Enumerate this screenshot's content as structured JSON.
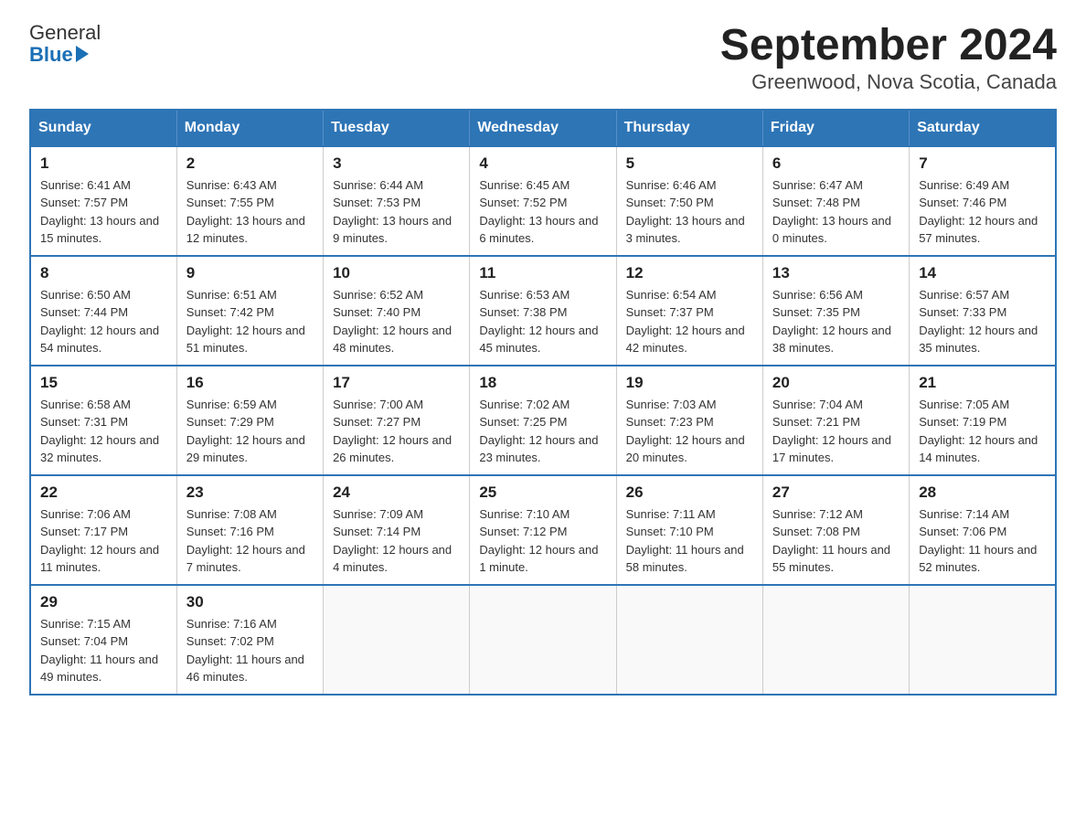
{
  "logo": {
    "text_general": "General",
    "text_blue": "Blue"
  },
  "title": "September 2024",
  "subtitle": "Greenwood, Nova Scotia, Canada",
  "days_header": [
    "Sunday",
    "Monday",
    "Tuesday",
    "Wednesday",
    "Thursday",
    "Friday",
    "Saturday"
  ],
  "weeks": [
    [
      {
        "day": "1",
        "sunrise": "6:41 AM",
        "sunset": "7:57 PM",
        "daylight": "13 hours and 15 minutes."
      },
      {
        "day": "2",
        "sunrise": "6:43 AM",
        "sunset": "7:55 PM",
        "daylight": "13 hours and 12 minutes."
      },
      {
        "day": "3",
        "sunrise": "6:44 AM",
        "sunset": "7:53 PM",
        "daylight": "13 hours and 9 minutes."
      },
      {
        "day": "4",
        "sunrise": "6:45 AM",
        "sunset": "7:52 PM",
        "daylight": "13 hours and 6 minutes."
      },
      {
        "day": "5",
        "sunrise": "6:46 AM",
        "sunset": "7:50 PM",
        "daylight": "13 hours and 3 minutes."
      },
      {
        "day": "6",
        "sunrise": "6:47 AM",
        "sunset": "7:48 PM",
        "daylight": "13 hours and 0 minutes."
      },
      {
        "day": "7",
        "sunrise": "6:49 AM",
        "sunset": "7:46 PM",
        "daylight": "12 hours and 57 minutes."
      }
    ],
    [
      {
        "day": "8",
        "sunrise": "6:50 AM",
        "sunset": "7:44 PM",
        "daylight": "12 hours and 54 minutes."
      },
      {
        "day": "9",
        "sunrise": "6:51 AM",
        "sunset": "7:42 PM",
        "daylight": "12 hours and 51 minutes."
      },
      {
        "day": "10",
        "sunrise": "6:52 AM",
        "sunset": "7:40 PM",
        "daylight": "12 hours and 48 minutes."
      },
      {
        "day": "11",
        "sunrise": "6:53 AM",
        "sunset": "7:38 PM",
        "daylight": "12 hours and 45 minutes."
      },
      {
        "day": "12",
        "sunrise": "6:54 AM",
        "sunset": "7:37 PM",
        "daylight": "12 hours and 42 minutes."
      },
      {
        "day": "13",
        "sunrise": "6:56 AM",
        "sunset": "7:35 PM",
        "daylight": "12 hours and 38 minutes."
      },
      {
        "day": "14",
        "sunrise": "6:57 AM",
        "sunset": "7:33 PM",
        "daylight": "12 hours and 35 minutes."
      }
    ],
    [
      {
        "day": "15",
        "sunrise": "6:58 AM",
        "sunset": "7:31 PM",
        "daylight": "12 hours and 32 minutes."
      },
      {
        "day": "16",
        "sunrise": "6:59 AM",
        "sunset": "7:29 PM",
        "daylight": "12 hours and 29 minutes."
      },
      {
        "day": "17",
        "sunrise": "7:00 AM",
        "sunset": "7:27 PM",
        "daylight": "12 hours and 26 minutes."
      },
      {
        "day": "18",
        "sunrise": "7:02 AM",
        "sunset": "7:25 PM",
        "daylight": "12 hours and 23 minutes."
      },
      {
        "day": "19",
        "sunrise": "7:03 AM",
        "sunset": "7:23 PM",
        "daylight": "12 hours and 20 minutes."
      },
      {
        "day": "20",
        "sunrise": "7:04 AM",
        "sunset": "7:21 PM",
        "daylight": "12 hours and 17 minutes."
      },
      {
        "day": "21",
        "sunrise": "7:05 AM",
        "sunset": "7:19 PM",
        "daylight": "12 hours and 14 minutes."
      }
    ],
    [
      {
        "day": "22",
        "sunrise": "7:06 AM",
        "sunset": "7:17 PM",
        "daylight": "12 hours and 11 minutes."
      },
      {
        "day": "23",
        "sunrise": "7:08 AM",
        "sunset": "7:16 PM",
        "daylight": "12 hours and 7 minutes."
      },
      {
        "day": "24",
        "sunrise": "7:09 AM",
        "sunset": "7:14 PM",
        "daylight": "12 hours and 4 minutes."
      },
      {
        "day": "25",
        "sunrise": "7:10 AM",
        "sunset": "7:12 PM",
        "daylight": "12 hours and 1 minute."
      },
      {
        "day": "26",
        "sunrise": "7:11 AM",
        "sunset": "7:10 PM",
        "daylight": "11 hours and 58 minutes."
      },
      {
        "day": "27",
        "sunrise": "7:12 AM",
        "sunset": "7:08 PM",
        "daylight": "11 hours and 55 minutes."
      },
      {
        "day": "28",
        "sunrise": "7:14 AM",
        "sunset": "7:06 PM",
        "daylight": "11 hours and 52 minutes."
      }
    ],
    [
      {
        "day": "29",
        "sunrise": "7:15 AM",
        "sunset": "7:04 PM",
        "daylight": "11 hours and 49 minutes."
      },
      {
        "day": "30",
        "sunrise": "7:16 AM",
        "sunset": "7:02 PM",
        "daylight": "11 hours and 46 minutes."
      },
      null,
      null,
      null,
      null,
      null
    ]
  ],
  "labels": {
    "sunrise": "Sunrise:",
    "sunset": "Sunset:",
    "daylight": "Daylight:"
  }
}
